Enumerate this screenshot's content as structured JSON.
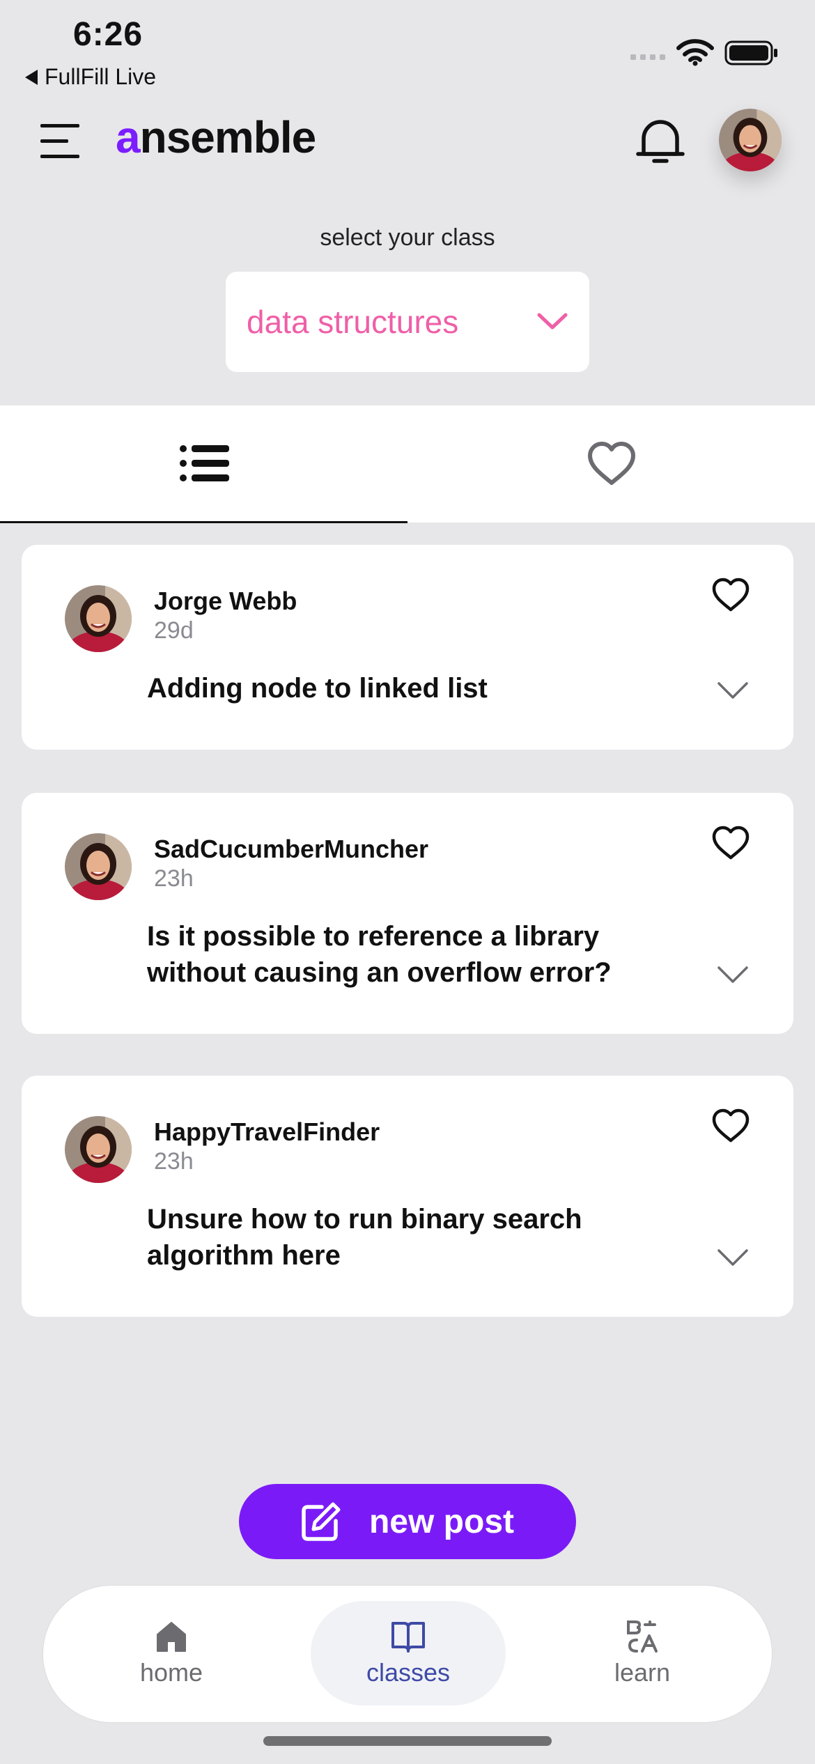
{
  "status_bar": {
    "time": "6:26",
    "back_app": "FullFill Live"
  },
  "header": {
    "logo_accent": "a",
    "logo_rest": "nsemble"
  },
  "class_selector": {
    "label": "select your class",
    "value": "data structures"
  },
  "colors": {
    "accent_purple": "#7a1bf7",
    "select_pink": "#ef5fa7",
    "nav_active": "#3e4aa6",
    "background": "#e7e7e9"
  },
  "tabs": [
    {
      "icon": "list-icon",
      "selected": true
    },
    {
      "icon": "heart-outline-icon",
      "selected": false
    }
  ],
  "posts": [
    {
      "author": "Jorge Webb",
      "age": "29d",
      "title": "Adding node to linked list"
    },
    {
      "author": "SadCucumberMuncher",
      "age": "23h",
      "title": "Is it possible to reference a library without causing an overflow error?"
    },
    {
      "author": "HappyTravelFinder",
      "age": "23h",
      "title": "Unsure how to run binary search algorithm here"
    }
  ],
  "actions": {
    "new_post": "new post"
  },
  "bottom_nav": [
    {
      "label": "home",
      "icon": "home-icon"
    },
    {
      "label": "classes",
      "icon": "book-icon",
      "active": true
    },
    {
      "label": "learn",
      "icon": "translate-icon"
    }
  ]
}
